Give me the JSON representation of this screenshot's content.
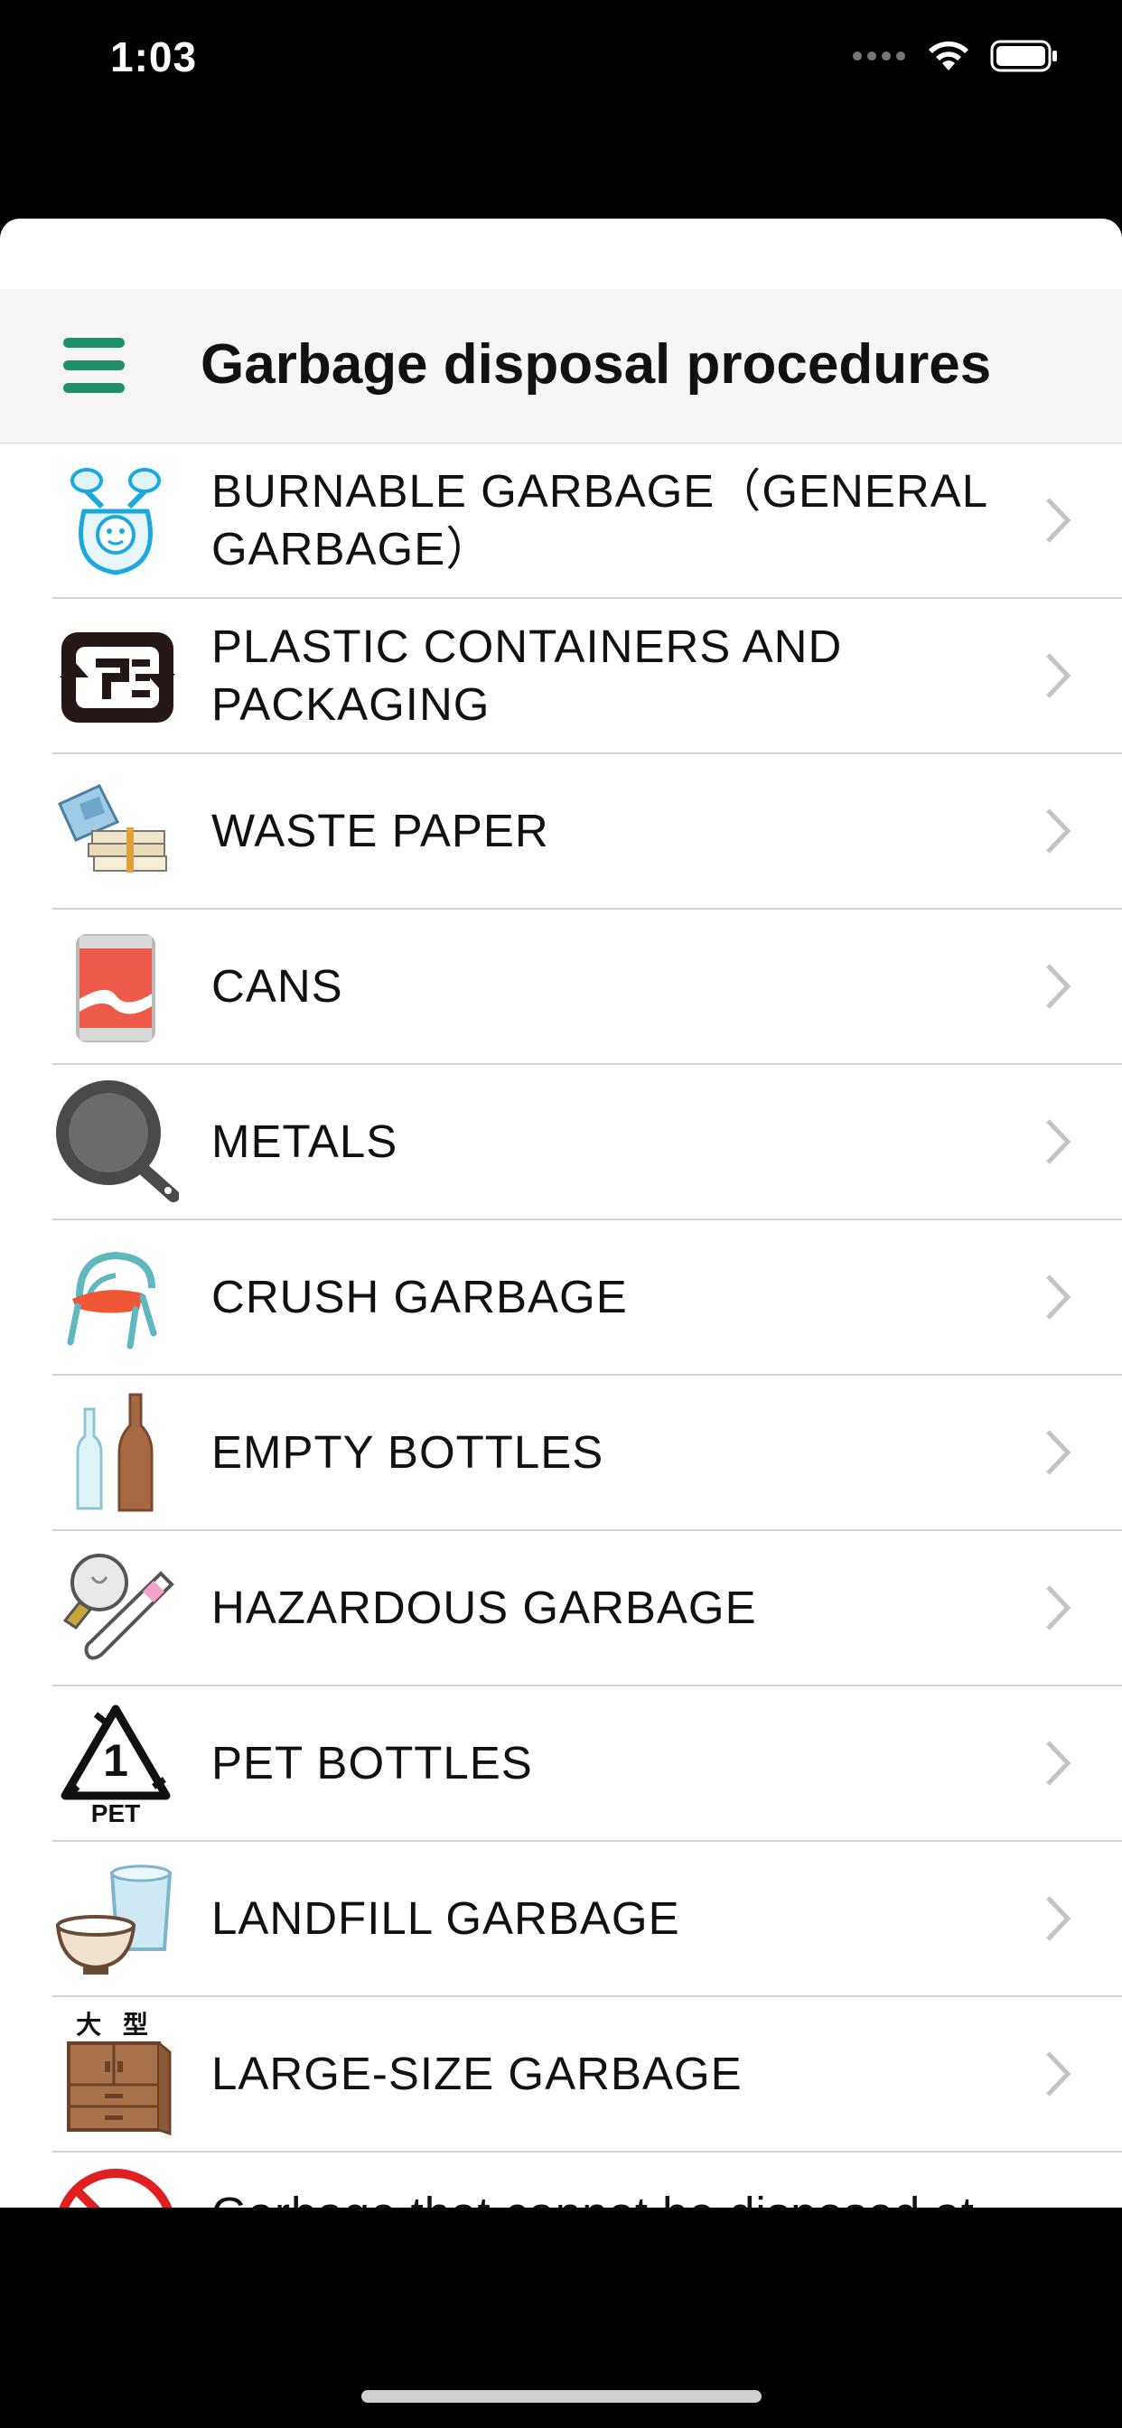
{
  "status_bar": {
    "time": "1:03"
  },
  "nav": {
    "title": "Garbage disposal procedures",
    "menu_icon": "hamburger-menu-icon"
  },
  "list": {
    "items": [
      {
        "label": "BURNABLE GARBAGE（GENERAL GARBAGE）",
        "icon": "burnable-garbage-bag-icon"
      },
      {
        "label": "PLASTIC CONTAINERS AND PACKAGING",
        "icon": "plastic-recycle-mark-icon"
      },
      {
        "label": "WASTE PAPER",
        "icon": "waste-paper-icon"
      },
      {
        "label": "CANS",
        "icon": "can-icon"
      },
      {
        "label": "METALS",
        "icon": "frying-pan-icon"
      },
      {
        "label": "CRUSH GARBAGE",
        "icon": "chair-icon"
      },
      {
        "label": "EMPTY BOTTLES",
        "icon": "bottles-icon"
      },
      {
        "label": "HAZARDOUS GARBAGE",
        "icon": "lightbulb-thermometer-icon"
      },
      {
        "label": "PET BOTTLES",
        "icon": "pet-recycle-mark-icon",
        "icon_text": "1",
        "icon_caption": "PET"
      },
      {
        "label": "LANDFILL GARBAGE",
        "icon": "bowl-and-glass-icon"
      },
      {
        "label": "LARGE-SIZE GARBAGE",
        "icon": "cabinet-icon",
        "icon_caption": "大 型"
      },
      {
        "label": "Garbage that cannot be disposed at",
        "icon": "prohibited-icon"
      }
    ]
  },
  "colors": {
    "accent": "#1f8f69",
    "chevron": "#c4c4c8"
  }
}
